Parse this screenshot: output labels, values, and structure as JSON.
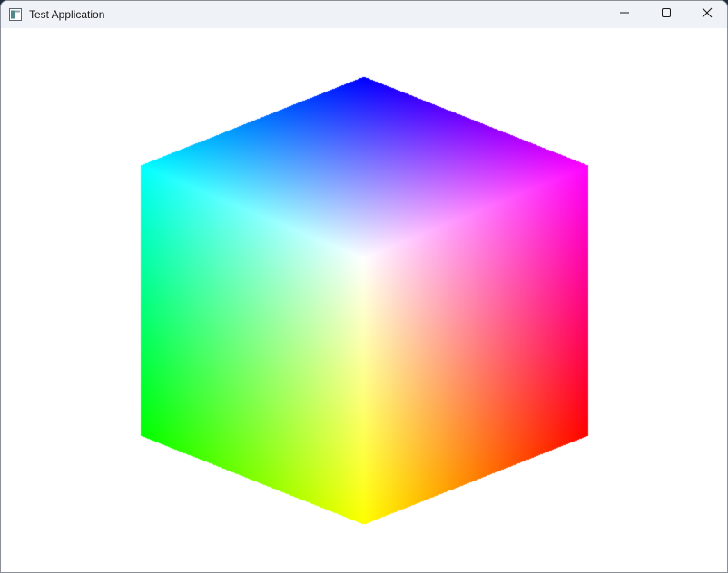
{
  "window": {
    "title": "Test Application",
    "icon": "app-window-icon"
  },
  "controls": {
    "minimize_icon": "minimize-icon",
    "maximize_icon": "maximize-icon",
    "close_icon": "close-icon"
  },
  "cube": {
    "center_color": "#ffffff",
    "vertex_colors": {
      "top": "#0000ff",
      "upper_right": "#ff00ff",
      "lower_right": "#ff0000",
      "bottom": "#ffff00",
      "lower_left": "#00ff00",
      "upper_left": "#00ffff"
    }
  }
}
